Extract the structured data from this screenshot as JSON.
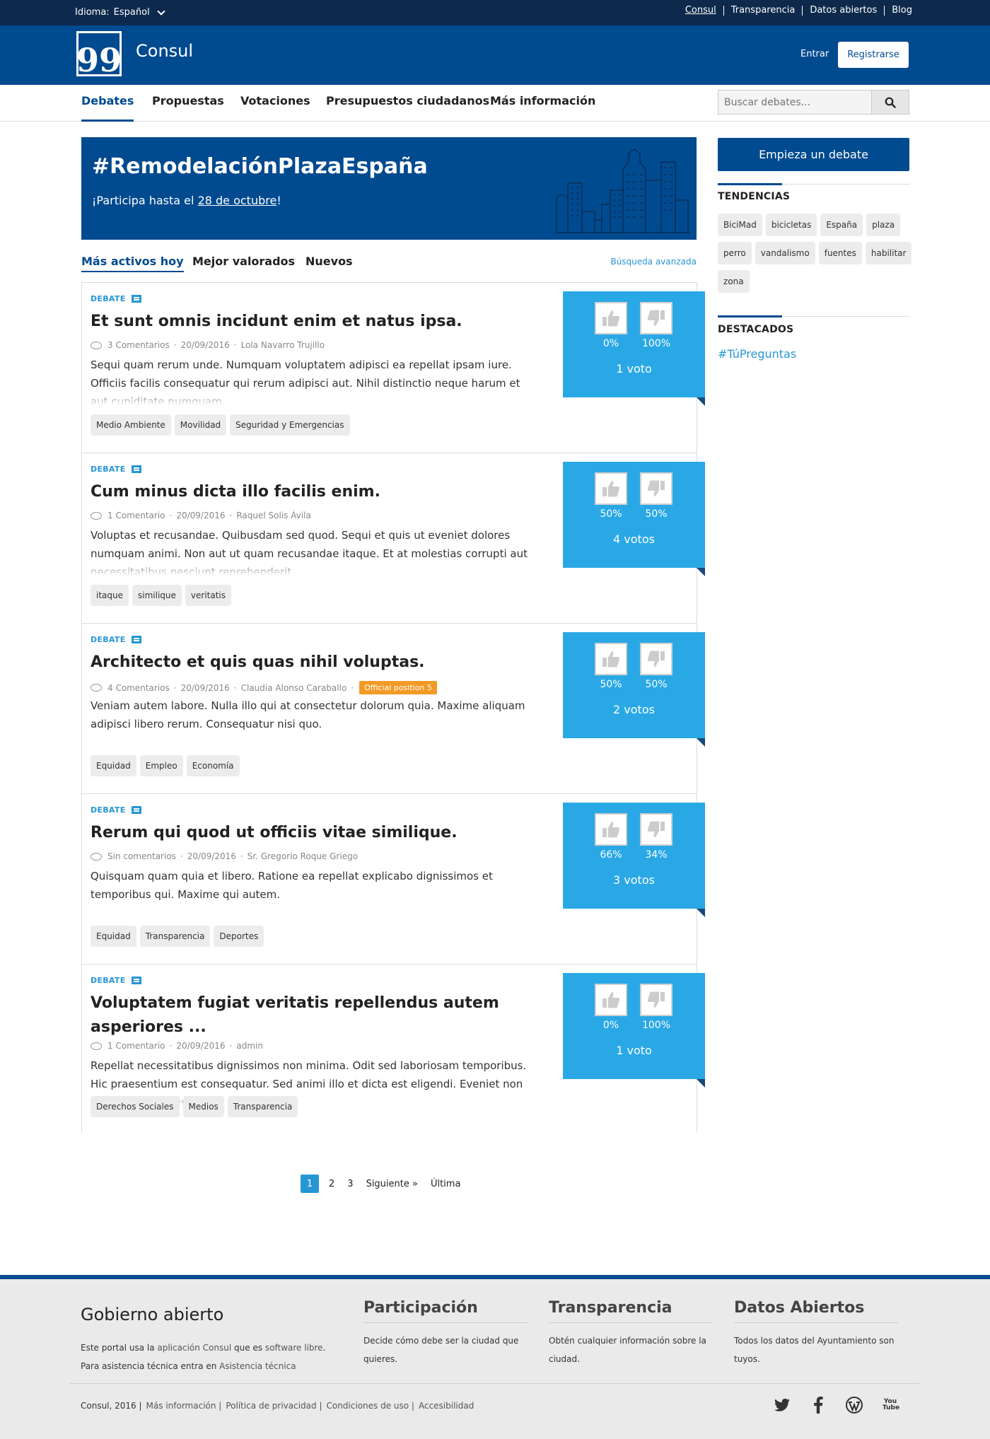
{
  "topbar": {
    "language_label": "Idioma:",
    "language_value": "Español",
    "links": [
      "Consul",
      "Transparencia",
      "Datos abiertos",
      "Blog"
    ]
  },
  "header": {
    "logo_glyph": "99",
    "brand": "Consul",
    "login": "Entrar",
    "register": "Registrarse"
  },
  "nav": {
    "tabs": [
      "Debates",
      "Propuestas",
      "Votaciones",
      "Presupuestos ciudadanos",
      "Más información"
    ],
    "active_tab": "Debates",
    "search_placeholder": "Buscar debates..."
  },
  "hero": {
    "title": "#RemodelaciónPlazaEspaña",
    "text_prefix": "¡Participa hasta el ",
    "date_link": "28 de octubre",
    "text_suffix": "!"
  },
  "order": {
    "tabs": [
      "Más activos hoy",
      "Mejor valorados",
      "Nuevos"
    ],
    "advanced_search": "Búsqueda avanzada"
  },
  "debates": [
    {
      "label": "DEBATE",
      "title": "Et sunt omnis incidunt enim et natus ipsa.",
      "comments": "3 Comentarios",
      "date": "20/09/2016",
      "author": "Lola Navarro Trujillo",
      "official": "",
      "description": "Sequi quam rerum unde. Numquam voluptatem adipisci ea repellat ipsam iure. Officiis facilis consequatur qui rerum adipisci aut. Nihil distinctio neque harum et aut cupiditate numquam.",
      "tags": [
        "Medio Ambiente",
        "Movilidad",
        "Seguridad y Emergencias"
      ],
      "likes_pct": "0%",
      "dislikes_pct": "100%",
      "votes": "1 voto"
    },
    {
      "label": "DEBATE",
      "title": "Cum minus dicta illo facilis enim.",
      "comments": "1 Comentario",
      "date": "20/09/2016",
      "author": "Raquel Solis Ávila",
      "official": "",
      "description": "Voluptas et recusandae. Quibusdam sed quod. Sequi et quis ut eveniet dolores numquam animi. Non aut ut quam recusandae itaque. Et at molestias corrupti aut necessitatibus nesciunt reprehenderit.",
      "tags": [
        "itaque",
        "similique",
        "veritatis"
      ],
      "likes_pct": "50%",
      "dislikes_pct": "50%",
      "votes": "4 votos"
    },
    {
      "label": "DEBATE",
      "title": "Architecto et quis quas nihil voluptas.",
      "comments": "4 Comentarios",
      "date": "20/09/2016",
      "author": "Claudia Alonso Caraballo",
      "official": "Official position 5",
      "description": "Veniam autem labore. Nulla illo qui at consectetur dolorum quia. Maxime aliquam adipisci libero rerum. Consequatur nisi quo.",
      "tags": [
        "Equidad",
        "Empleo",
        "Economía"
      ],
      "likes_pct": "50%",
      "dislikes_pct": "50%",
      "votes": "2 votos"
    },
    {
      "label": "DEBATE",
      "title": "Rerum qui quod ut officiis vitae similique.",
      "comments": "Sin comentarios",
      "date": "20/09/2016",
      "author": "Sr. Gregorio Roque Griego",
      "official": "",
      "description": "Quisquam quam quia et libero. Ratione ea repellat explicabo dignissimos et temporibus qui. Maxime qui autem.",
      "tags": [
        "Equidad",
        "Transparencia",
        "Deportes"
      ],
      "likes_pct": "66%",
      "dislikes_pct": "34%",
      "votes": "3 votos"
    },
    {
      "label": "DEBATE",
      "title": "Voluptatem fugiat veritatis repellendus autem asperiores ...",
      "comments": "1 Comentario",
      "date": "20/09/2016",
      "author": "admin",
      "official": "",
      "description": "Repellat necessitatibus dignissimos non minima. Odit sed laboriosam temporibus. Hic praesentium est consequatur. Sed animi illo et dicta est eligendi. Eveniet non repellendus deserunt qui.",
      "tags": [
        "Derechos Sociales",
        "Medios",
        "Transparencia"
      ],
      "likes_pct": "0%",
      "dislikes_pct": "100%",
      "votes": "1 voto"
    }
  ],
  "pagination": {
    "pages": [
      "1",
      "2",
      "3"
    ],
    "current": "1",
    "next": "Siguiente »",
    "last": "Última"
  },
  "sidebar": {
    "start_debate": "Empieza un debate",
    "trending_title": "TENDENCIAS",
    "trending_tags": [
      "BiciMad",
      "bicicletas",
      "España",
      "plaza",
      "perro",
      "vandalismo",
      "fuentes",
      "habilitar",
      "zona"
    ],
    "featured_title": "DESTACADOS",
    "featured_link": "#TúPreguntas"
  },
  "footer": {
    "title": "Gobierno abierto",
    "text_1": "Este portal usa la ",
    "link_app": "aplicación Consul",
    "text_2": " que es ",
    "link_free": "software libre",
    "text_3": ". Para asistencia técnica entra en ",
    "link_support": "Asistencia técnica",
    "columns": [
      {
        "title": "Participación",
        "text": "Decide cómo debe ser la ciudad que quieres."
      },
      {
        "title": "Transparencia",
        "text": "Obtén cualquier información sobre la ciudad."
      },
      {
        "title": "Datos Abiertos",
        "text": "Todos los datos del Ayuntamiento son tuyos."
      }
    ],
    "copyright": "Consul, 2016 |",
    "bottom_links": [
      "Más información |",
      "Política de privacidad |",
      "Condiciones de uso |",
      "Accesibilidad"
    ],
    "social_icons": [
      "twitter-icon",
      "facebook-icon",
      "wordpress-icon",
      "youtube-icon"
    ],
    "youtube_glyph": "You Tube"
  },
  "colors": {
    "topbar": "#0d2a4d",
    "brand": "#004a8f",
    "accent": "#2796d5",
    "votes_box": "#2aa8e6",
    "official_badge": "#f29a25"
  }
}
